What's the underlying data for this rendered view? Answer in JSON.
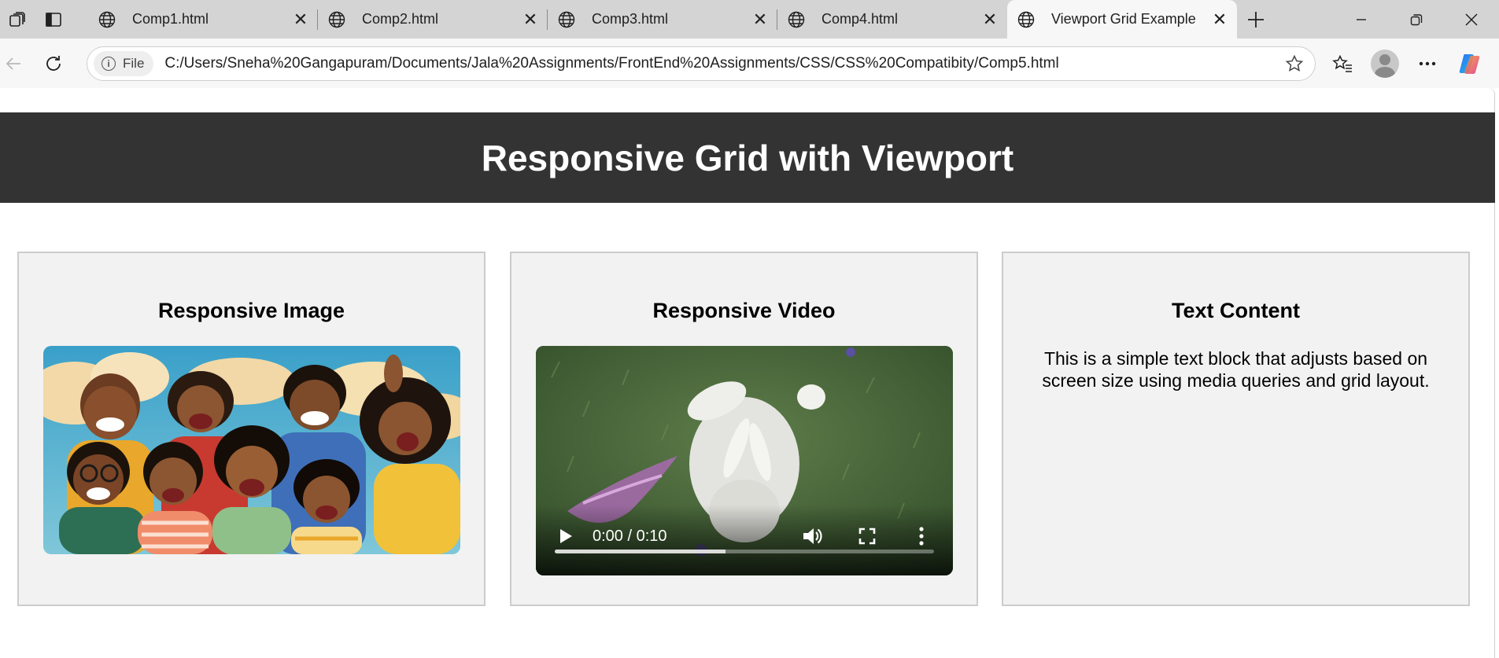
{
  "browser": {
    "tabs": [
      {
        "title": "Comp1.html",
        "active": false
      },
      {
        "title": "Comp2.html",
        "active": false
      },
      {
        "title": "Comp3.html",
        "active": false
      },
      {
        "title": "Comp4.html",
        "active": false
      },
      {
        "title": "Viewport Grid Example",
        "active": true
      }
    ],
    "address": {
      "chip_label": "File",
      "url": "C:/Users/Sneha%20Gangapuram/Documents/Jala%20Assignments/FrontEnd%20Assignments/CSS/CSS%20Compatibity/Comp5.html"
    }
  },
  "page": {
    "header_title": "Responsive Grid with Viewport",
    "cards": [
      {
        "heading": "Responsive Image"
      },
      {
        "heading": "Responsive Video"
      },
      {
        "heading": "Text Content",
        "body": "This is a simple text block that adjusts based on screen size using media queries and grid layout."
      }
    ],
    "video": {
      "time_display": "0:00 / 0:10",
      "buffered_fraction": 0.45
    }
  },
  "colors": {
    "header_bg": "#333333",
    "card_bg": "#f2f2f2",
    "card_border": "#cccccc"
  }
}
